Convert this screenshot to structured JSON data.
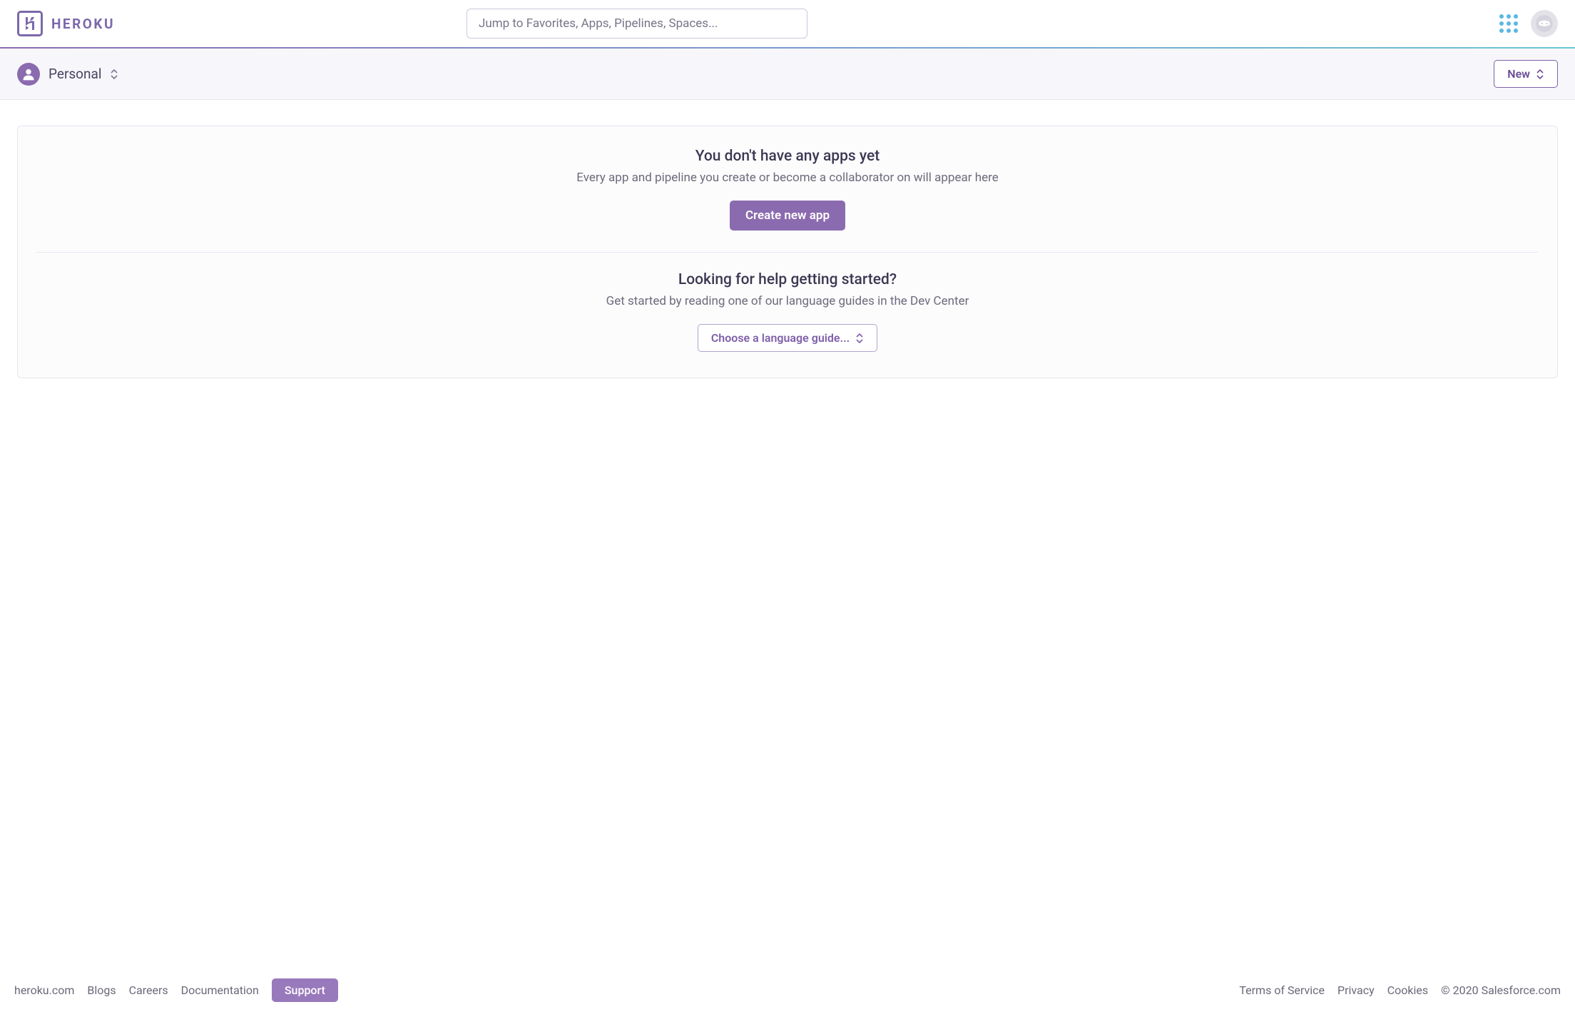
{
  "header": {
    "brand": "HEROKU",
    "search_placeholder": "Jump to Favorites, Apps, Pipelines, Spaces..."
  },
  "context": {
    "team_label": "Personal",
    "new_button": "New"
  },
  "empty": {
    "title1": "You don't have any apps yet",
    "sub1": "Every app and pipeline you create or become a collaborator on will appear here",
    "cta1": "Create new app",
    "title2": "Looking for help getting started?",
    "sub2": "Get started by reading one of our language guides in the Dev Center",
    "cta2": "Choose a language guide..."
  },
  "footer": {
    "links_left": {
      "home": "heroku.com",
      "blogs": "Blogs",
      "careers": "Careers",
      "docs": "Documentation",
      "support": "Support"
    },
    "links_right": {
      "tos": "Terms of Service",
      "privacy": "Privacy",
      "cookies": "Cookies"
    },
    "copyright": "© 2020 Salesforce.com"
  }
}
